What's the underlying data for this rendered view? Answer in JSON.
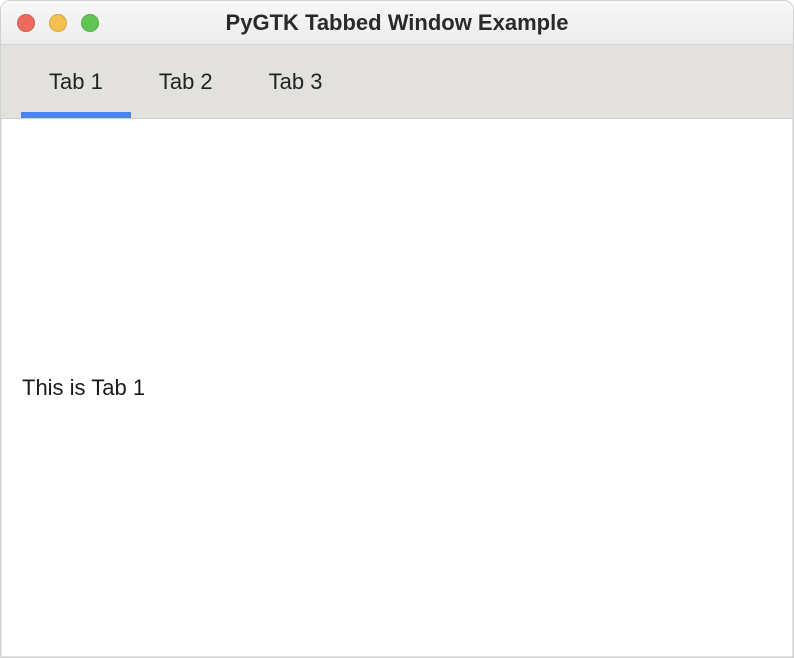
{
  "window": {
    "title": "PyGTK Tabbed Window Example"
  },
  "tabs": [
    {
      "label": "Tab 1",
      "active": true
    },
    {
      "label": "Tab 2",
      "active": false
    },
    {
      "label": "Tab 3",
      "active": false
    }
  ],
  "content": {
    "text": "This is Tab 1"
  }
}
